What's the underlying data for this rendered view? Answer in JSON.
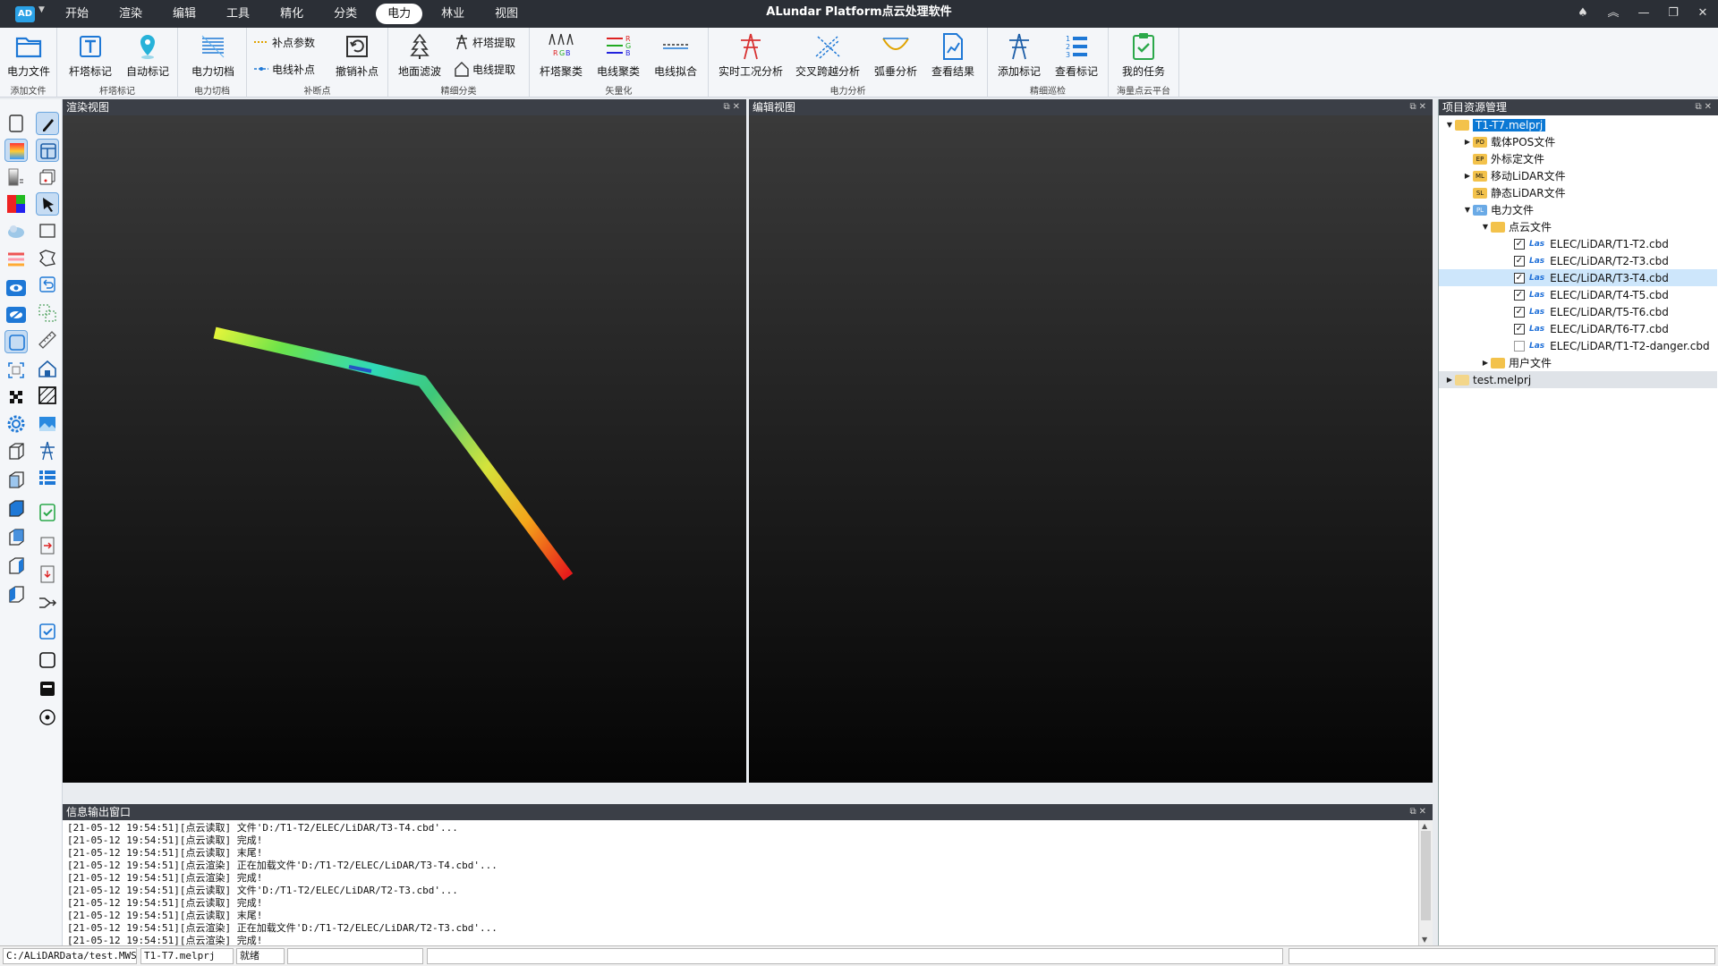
{
  "titlebar": {
    "logo": "AD",
    "title": "ALundar Platform点云处理软件",
    "menu": [
      "开始",
      "渲染",
      "编辑",
      "工具",
      "精化",
      "分类",
      "电力",
      "林业",
      "视图"
    ],
    "active_menu": "电力"
  },
  "ribbon": {
    "groups": [
      "添加文件",
      "杆塔标记",
      "电力切档",
      "补断点",
      "精细分类",
      "矢量化",
      "电力分析",
      "精细巡检",
      "海量点云平台"
    ],
    "buttons": {
      "power_file": "电力文件",
      "tower_mark": "杆塔标记",
      "auto_mark": "自动标记",
      "power_cut": "电力切档",
      "fill_params": "补点参数",
      "line_fill": "电线补点",
      "undo_fill": "撤销补点",
      "ground_filter": "地面滤波",
      "tower_extract": "杆塔提取",
      "line_extract": "电线提取",
      "tower_cluster": "杆塔聚类",
      "line_cluster": "电线聚类",
      "line_fit": "电线拟合",
      "realtime_analysis": "实时工况分析",
      "cross_analysis": "交叉跨越分析",
      "sag_analysis": "弧垂分析",
      "view_result": "查看结果",
      "add_mark": "添加标记",
      "view_mark": "查看标记",
      "my_tasks": "我的任务"
    }
  },
  "views": {
    "render": "渲染视图",
    "edit": "编辑视图"
  },
  "resource": {
    "title": "项目资源管理",
    "items": [
      {
        "label": "T1-T7.melprj"
      },
      {
        "label": "载体POS文件"
      },
      {
        "label": "外标定文件"
      },
      {
        "label": "移动LiDAR文件"
      },
      {
        "label": "静态LiDAR文件"
      },
      {
        "label": "电力文件"
      },
      {
        "label": "点云文件"
      },
      {
        "label": "ELEC/LiDAR/T1-T2.cbd",
        "checked": true
      },
      {
        "label": "ELEC/LiDAR/T2-T3.cbd",
        "checked": true
      },
      {
        "label": "ELEC/LiDAR/T3-T4.cbd",
        "checked": true
      },
      {
        "label": "ELEC/LiDAR/T4-T5.cbd",
        "checked": true
      },
      {
        "label": "ELEC/LiDAR/T5-T6.cbd",
        "checked": true
      },
      {
        "label": "ELEC/LiDAR/T6-T7.cbd",
        "checked": true
      },
      {
        "label": "ELEC/LiDAR/T1-T2-danger.cbd",
        "checked": false
      },
      {
        "label": "用户文件"
      },
      {
        "label": "test.melprj"
      }
    ],
    "las_tag": "Las",
    "file_tags": {
      "pos": "PO",
      "ep": "EP",
      "ml": "ML",
      "sl": "SL",
      "pl": "PL"
    }
  },
  "log": {
    "title": "信息输出窗口",
    "lines": [
      "[21-05-12 19:54:51][点云读取] 文件'D:/T1-T2/ELEC/LiDAR/T3-T4.cbd'...",
      "[21-05-12 19:54:51][点云读取] 完成!",
      "[21-05-12 19:54:51][点云读取] 末尾!",
      "[21-05-12 19:54:51][点云渲染] 正在加载文件'D:/T1-T2/ELEC/LiDAR/T3-T4.cbd'...",
      "[21-05-12 19:54:51][点云渲染] 完成!",
      "[21-05-12 19:54:51][点云读取] 文件'D:/T1-T2/ELEC/LiDAR/T2-T3.cbd'...",
      "[21-05-12 19:54:51][点云读取] 完成!",
      "[21-05-12 19:54:51][点云读取] 末尾!",
      "[21-05-12 19:54:51][点云渲染] 正在加载文件'D:/T1-T2/ELEC/LiDAR/T2-T3.cbd'...",
      "[21-05-12 19:54:51][点云渲染] 完成!"
    ]
  },
  "status": {
    "path": "C:/ALiDARData/test.MWS",
    "project": "T1-T7.melprj",
    "state": "就绪"
  }
}
